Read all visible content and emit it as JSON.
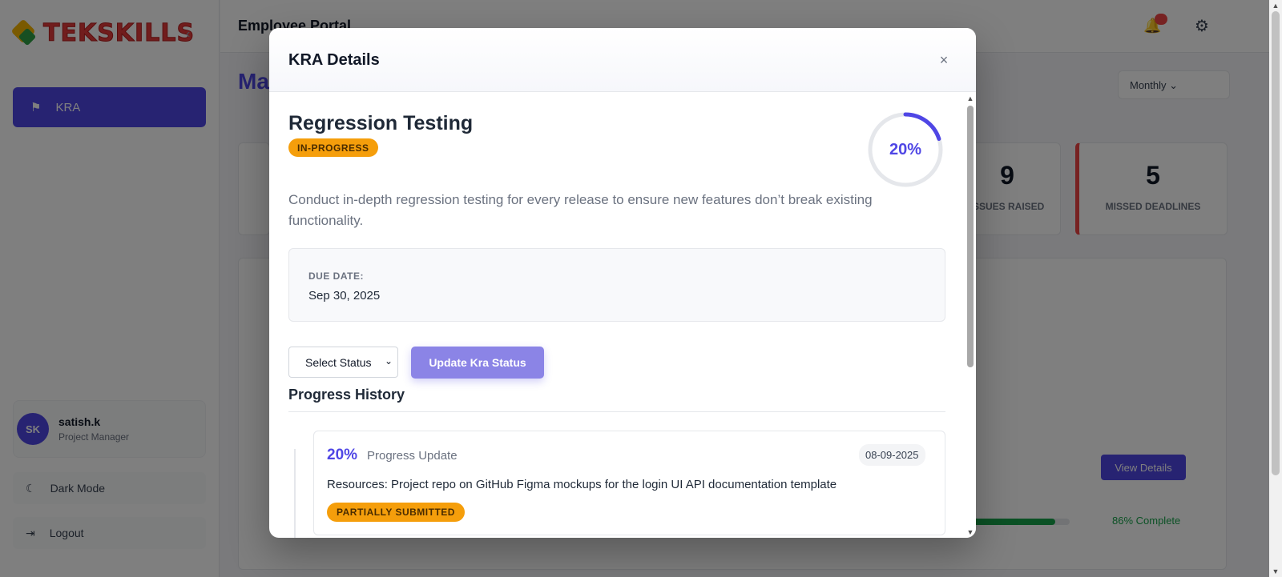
{
  "app": {
    "logo_text": "TEKSKILLS",
    "portal_title": "Employee Portal",
    "page_heading": "Ma",
    "nav_active_label": "KRA",
    "user": {
      "initials": "SK",
      "name": "satish.k",
      "role": "Project Manager"
    },
    "side_links": [
      "Dark Mode",
      "Logout"
    ],
    "month_filter": "Monthly",
    "stats": [
      {
        "value": "9",
        "label": "Issues Raised"
      },
      {
        "value": "5",
        "label": "Missed Deadlines"
      }
    ],
    "view_details_label": "View Details",
    "bg_progress": {
      "percent": 86,
      "label": "86% Complete"
    }
  },
  "modal": {
    "title": "KRA Details",
    "close_glyph": "×",
    "kra": {
      "name": "Regression Testing",
      "status": "IN-PROGRESS",
      "progress_percent": 20,
      "progress_label": "20%",
      "description": "Conduct in-depth regression testing for every release to ensure new features don’t break existing functionality.",
      "due_label": "DUE DATE:",
      "due_value": "Sep 30, 2025"
    },
    "status_select": {
      "selected": "Select Status"
    },
    "update_button": "Update Kra Status",
    "history_title": "Progress History",
    "history": [
      {
        "percent_label": "20%",
        "type": "Progress Update",
        "date": "08-09-2025",
        "text": "Resources: Project repo on GitHub Figma mockups for the login UI API documentation template",
        "badge": "PARTIALLY SUBMITTED"
      }
    ]
  },
  "colors": {
    "accent": "#4f46e5",
    "accent_light": "#8b84e6",
    "status_orange": "#f59e0b",
    "ring_track": "#e5e7eb",
    "success": "#16a34a"
  }
}
